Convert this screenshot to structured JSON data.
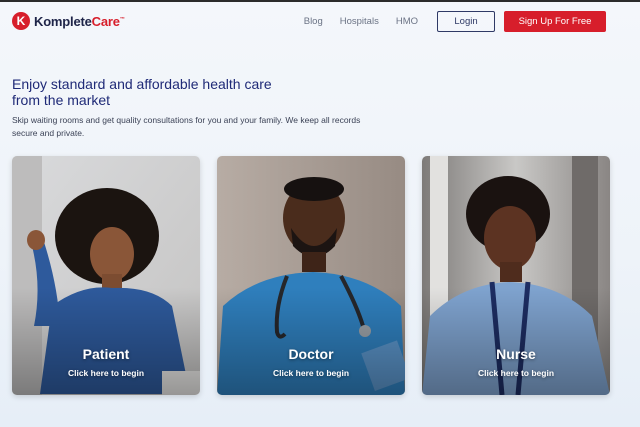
{
  "brand": {
    "name_main": "Komplete",
    "name_accent": "Care",
    "tm": "™",
    "logo_letter": "K",
    "color": "#d71e2b"
  },
  "nav": {
    "links": [
      "Blog",
      "Hospitals",
      "HMO"
    ],
    "login_label": "Login",
    "signup_label": "Sign Up For Free"
  },
  "hero": {
    "title": "Enjoy standard and affordable health care from the market",
    "subtitle": "Skip waiting rooms and get quality consultations for you and your family. We keep all records secure and private."
  },
  "cards": [
    {
      "title": "Patient",
      "cta": "Click here to begin"
    },
    {
      "title": "Doctor",
      "cta": "Click here to begin"
    },
    {
      "title": "Nurse",
      "cta": "Click here to begin"
    }
  ]
}
